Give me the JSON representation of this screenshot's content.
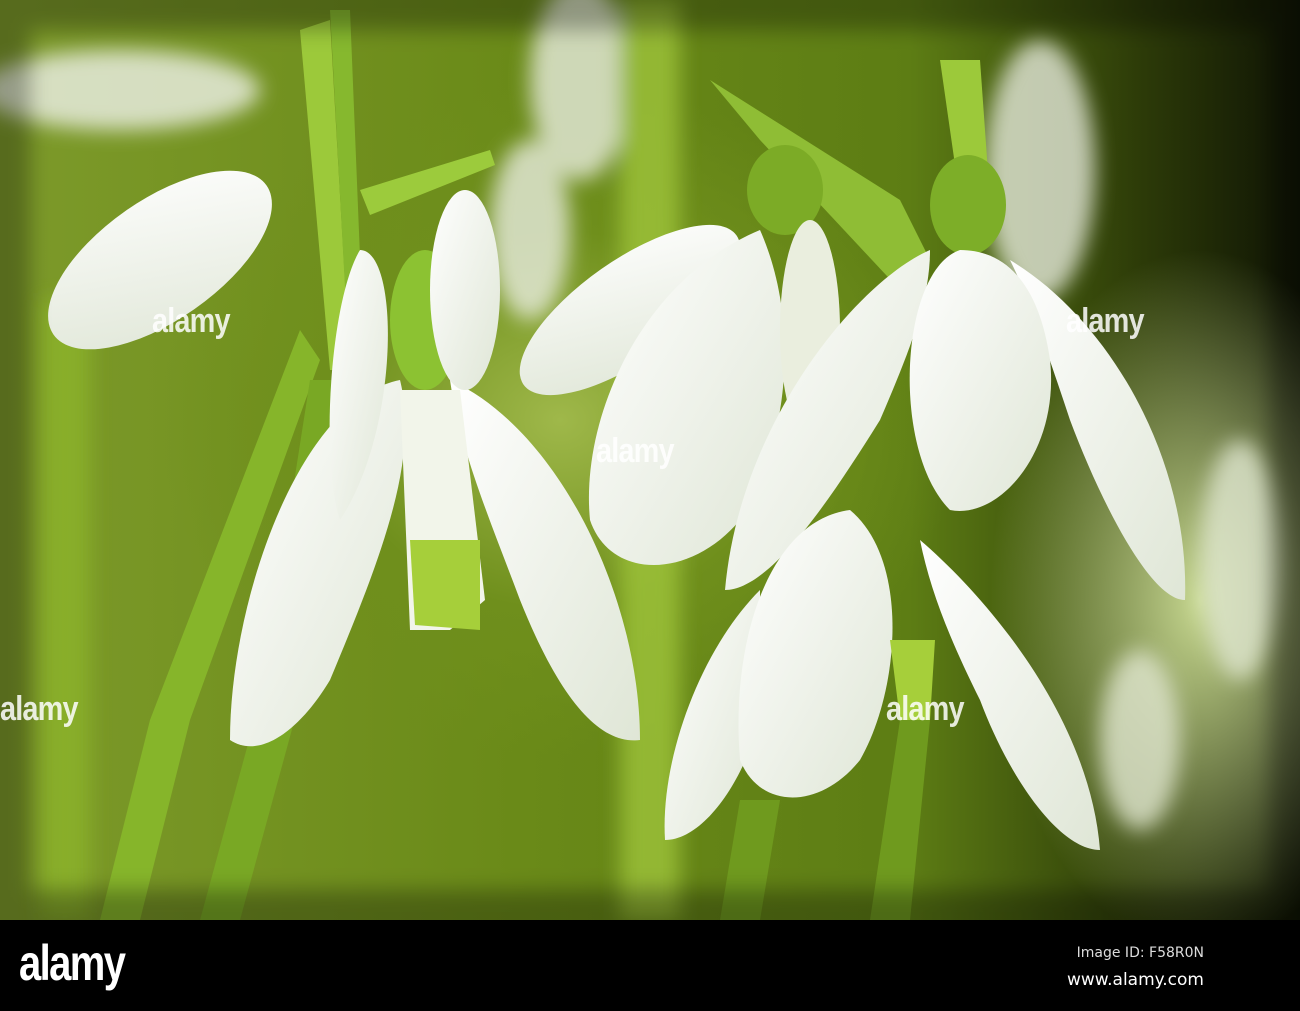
{
  "photo": {
    "subject": "snowdrops",
    "watermark_text": "alamy"
  },
  "footer": {
    "logo": "alamy",
    "image_id": "Image ID: F58R0N",
    "website": "www.alamy.com"
  },
  "colors": {
    "petal": "#f4f6f0",
    "stem": "#8dbb2a",
    "background": "#6a8a18",
    "bar": "#000000"
  }
}
